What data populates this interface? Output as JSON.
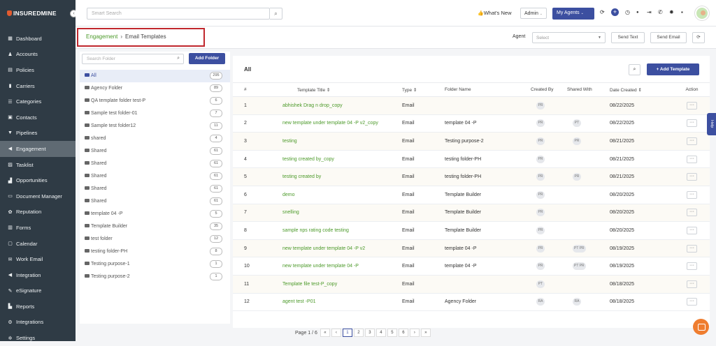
{
  "app": {
    "logo_text": "INSUREDMINE",
    "collapse": "‹"
  },
  "sidebar": {
    "items": [
      {
        "label": "Dashboard",
        "icon": "▦"
      },
      {
        "label": "Accounts",
        "icon": "♟"
      },
      {
        "label": "Policies",
        "icon": "▤"
      },
      {
        "label": "Carriers",
        "icon": "▮"
      },
      {
        "label": "Categories",
        "icon": "☰"
      },
      {
        "label": "Contacts",
        "icon": "▣"
      },
      {
        "label": "Pipelines",
        "icon": "▼"
      },
      {
        "label": "Engagement",
        "icon": "◀"
      },
      {
        "label": "Tasklist",
        "icon": "▨"
      },
      {
        "label": "Opportunities",
        "icon": "▟"
      },
      {
        "label": "Document Manager",
        "icon": "▭"
      },
      {
        "label": "Reputation",
        "icon": "✿"
      },
      {
        "label": "Forms",
        "icon": "▥"
      },
      {
        "label": "Calendar",
        "icon": "▢"
      },
      {
        "label": "Work Email",
        "icon": "✉"
      },
      {
        "label": "Integration",
        "icon": "◀"
      },
      {
        "label": "eSignature",
        "icon": "✎"
      },
      {
        "label": "Reports",
        "icon": "▙"
      },
      {
        "label": "Integrations",
        "icon": "⚙"
      },
      {
        "label": "Settings",
        "icon": "✲"
      }
    ]
  },
  "topbar": {
    "search_placeholder": "Smart Search",
    "search_icon": "⌕",
    "whats_new": "What's New",
    "whats_new_icon": "👍",
    "admin": "Admin",
    "my_agents": "My Agents",
    "icons": {
      "refresh": "⟳",
      "plus": "+",
      "clock": "◷",
      "bell": "●",
      "logout": "⇥",
      "phone": "✆",
      "settings": "✹",
      "message": "▪"
    }
  },
  "subheader": {
    "breadcrumb_link": "Engagement",
    "breadcrumb_sep": "›",
    "breadcrumb_current": "Email Templates",
    "agent_label": "Agent",
    "agent_placeholder": "Select",
    "send_text": "Send Text",
    "send_email": "Send Email",
    "refresh": "⟳"
  },
  "folders": {
    "search_placeholder": "Search Folder",
    "add_folder": "Add Folder",
    "items": [
      {
        "name": "All",
        "count": "295"
      },
      {
        "name": "Agency Folder",
        "count": "89"
      },
      {
        "name": "QA template folder test-P",
        "count": "6"
      },
      {
        "name": "Sample test folder-01",
        "count": "7"
      },
      {
        "name": "Sample test folder12",
        "count": "11"
      },
      {
        "name": "shared",
        "count": "4"
      },
      {
        "name": "Shared",
        "count": "61"
      },
      {
        "name": "Shared",
        "count": "61"
      },
      {
        "name": "Shared",
        "count": "61"
      },
      {
        "name": "Shared",
        "count": "61"
      },
      {
        "name": "Shared",
        "count": "61"
      },
      {
        "name": "template 04 -P",
        "count": "5"
      },
      {
        "name": "Template Builder",
        "count": "35"
      },
      {
        "name": "test folder",
        "count": "12"
      },
      {
        "name": "testing folder-PH",
        "count": "8"
      },
      {
        "name": "Testing purpose-1",
        "count": "1"
      },
      {
        "name": "Testing purpose-2",
        "count": "1"
      }
    ]
  },
  "main": {
    "title": "All",
    "search_icon": "⌕",
    "add_template": "+ Add Template",
    "columns": [
      "#",
      "Template Title ⇕",
      "Type ⇕",
      "Folder Name",
      "Created By",
      "Shared With",
      "Date Created ⇕",
      "Action"
    ],
    "rows": [
      {
        "num": "1",
        "title": "abhishek Drag n drop_copy",
        "type": "Email",
        "folder": "",
        "created_by": "PR",
        "shared": "",
        "date": "08/22/2025"
      },
      {
        "num": "2",
        "title": "new template under template 04 -P v2_copy",
        "type": "Email",
        "folder": "template 04 -P",
        "created_by": "PR",
        "shared": "PT",
        "date": "08/22/2025"
      },
      {
        "num": "3",
        "title": "testing",
        "type": "Email",
        "folder": "Testing purpose-2",
        "created_by": "PR",
        "shared": "PR",
        "date": "08/21/2025"
      },
      {
        "num": "4",
        "title": "testing created by_copy",
        "type": "Email",
        "folder": "testing folder-PH",
        "created_by": "PR",
        "shared": "",
        "date": "08/21/2025"
      },
      {
        "num": "5",
        "title": "testing created by",
        "type": "Email",
        "folder": "testing folder-PH",
        "created_by": "PR",
        "shared": "PR",
        "date": "08/21/2025"
      },
      {
        "num": "6",
        "title": "demo",
        "type": "Email",
        "folder": "Template Builder",
        "created_by": "PR",
        "shared": "",
        "date": "08/20/2025"
      },
      {
        "num": "7",
        "title": "snelling",
        "type": "Email",
        "folder": "Template Builder",
        "created_by": "PR",
        "shared": "",
        "date": "08/20/2025"
      },
      {
        "num": "8",
        "title": "sample nps rating code testing",
        "type": "Email",
        "folder": "Template Builder",
        "created_by": "PR",
        "shared": "",
        "date": "08/20/2025"
      },
      {
        "num": "9",
        "title": "new template under template 04 -P v2",
        "type": "Email",
        "folder": "template 04 -P",
        "created_by": "PR",
        "shared": "PT PR",
        "date": "08/19/2025"
      },
      {
        "num": "10",
        "title": "new template under template 04 -P",
        "type": "Email",
        "folder": "template 04 -P",
        "created_by": "PR",
        "shared": "PT PR",
        "date": "08/19/2025"
      },
      {
        "num": "11",
        "title": "Template file test-P_copy",
        "type": "Email",
        "folder": "",
        "created_by": "PT",
        "shared": "",
        "date": "08/18/2025"
      },
      {
        "num": "12",
        "title": "agent test -P01",
        "type": "Email",
        "folder": "Agency Folder",
        "created_by": "RA",
        "shared": "RA",
        "date": "08/18/2025"
      }
    ],
    "action_label": "···"
  },
  "pager": {
    "label": "Page 1 / 6",
    "first": "«",
    "prev": "‹",
    "pages": [
      "1",
      "2",
      "3",
      "4",
      "5",
      "6"
    ],
    "next": "›",
    "last": "»"
  },
  "help": {
    "label": "Help"
  },
  "colors": {
    "sidebar_bg": "#2f3b45",
    "primary": "#3c4fa0",
    "link_green": "#4c9a2a",
    "highlight_red": "#c0272d"
  }
}
